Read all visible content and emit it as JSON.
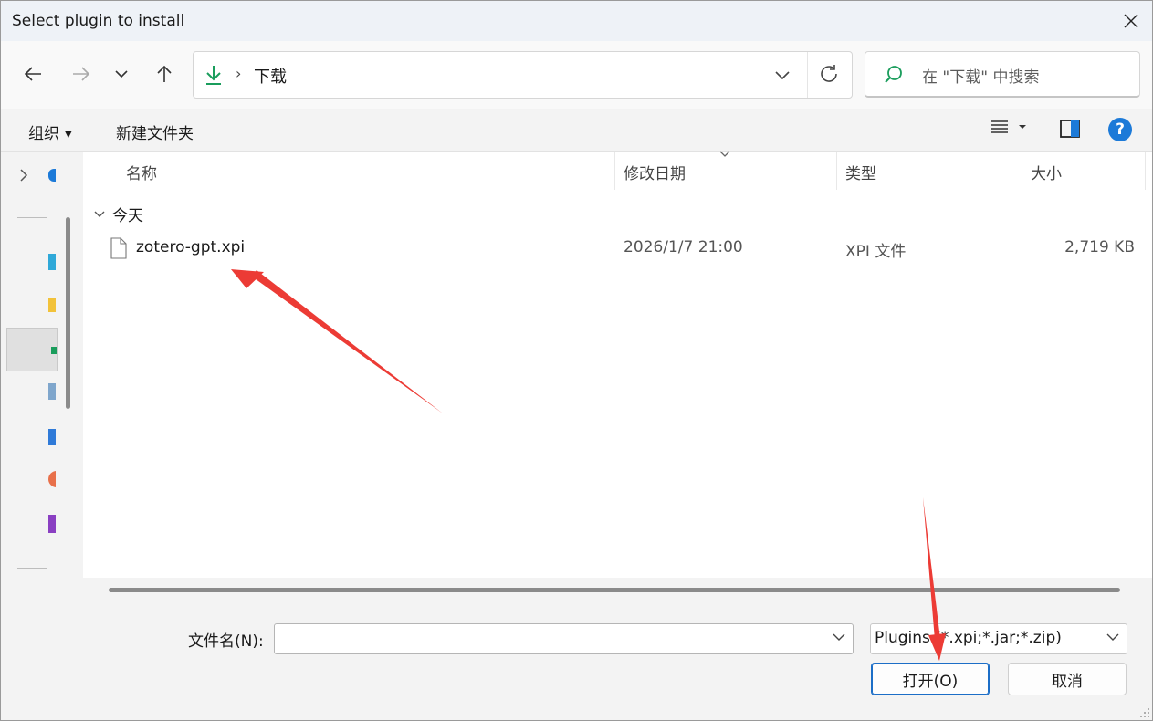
{
  "window": {
    "title": "Select plugin to install"
  },
  "nav": {
    "back_icon": "arrow-left-icon",
    "forward_icon": "arrow-right-icon",
    "recent_icon": "chevron-down-icon",
    "up_icon": "arrow-up-icon"
  },
  "address": {
    "separator": "›",
    "folder": "下载"
  },
  "search": {
    "placeholder": "在 \"下载\" 中搜索"
  },
  "toolbar": {
    "organize": "组织",
    "new_folder": "新建文件夹",
    "help": "?"
  },
  "columns": {
    "name": "名称",
    "date": "修改日期",
    "type": "类型",
    "size": "大小"
  },
  "group": {
    "label": "今天"
  },
  "files": [
    {
      "name": "zotero-gpt.xpi",
      "date": "2026/1/7 21:00",
      "type": "XPI 文件",
      "size": "2,719 KB"
    }
  ],
  "bottom": {
    "filename_label": "文件名(N):",
    "filename_value": "",
    "filetype_value": "Plugins (*.xpi;*.jar;*.zip)",
    "open_label": "打开(O)",
    "cancel_label": "取消"
  },
  "colors": {
    "accent": "#1c7ad8",
    "download_green": "#1a9d5c",
    "annotation_red": "#ec3b35"
  }
}
